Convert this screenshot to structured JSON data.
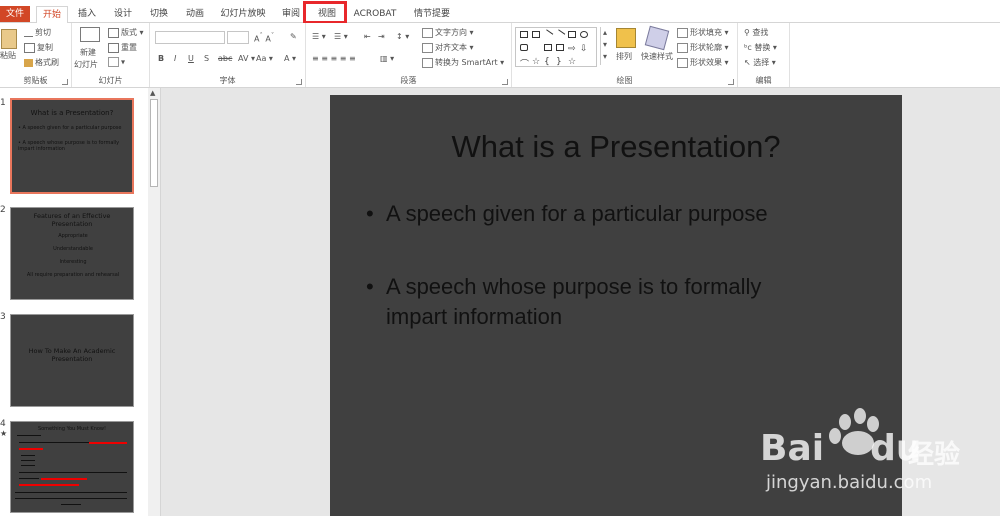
{
  "tabs": {
    "file": "文件",
    "home": "开始",
    "insert": "插入",
    "design": "设计",
    "transitions": "切换",
    "animations": "动画",
    "slideshow": "幻灯片放映",
    "review": "审阅",
    "view": "视图",
    "acrobat": "ACROBAT",
    "storyboard": "情节提要"
  },
  "ribbon": {
    "clipboard": {
      "paste": "粘贴",
      "cut": "剪切",
      "copy": "复制",
      "format_painter": "格式刷",
      "label": "剪贴板"
    },
    "slides": {
      "new_slide": "新建",
      "new_slide2": "幻灯片",
      "layout": "版式",
      "reset": "重置",
      "label": "幻灯片"
    },
    "font": {
      "label": "字体"
    },
    "paragraph": {
      "text_direction": "文字方向",
      "align_text": "对齐文本",
      "convert_smartart": "转换为 SmartArt",
      "label": "段落"
    },
    "drawing": {
      "arrange": "排列",
      "quick_styles": "快速样式",
      "shape_fill": "形状填充",
      "shape_outline": "形状轮廓",
      "shape_effects": "形状效果",
      "label": "绘图"
    },
    "editing": {
      "find": "查找",
      "replace": "替换",
      "select": "选择",
      "label": "编辑"
    }
  },
  "thumbnails": [
    {
      "num": "1",
      "title": "What is a Presentation?",
      "lines": [
        "• A speech given for a particular purpose",
        "• A speech whose purpose is to formally impart information"
      ]
    },
    {
      "num": "2",
      "title": "Features of an Effective Presentation",
      "lines": [
        "Appropriate",
        "Understandable",
        "Interesting",
        "All require preparation and rehearsal"
      ]
    },
    {
      "num": "3",
      "title": "How To Make An Academic Presentation",
      "lines": []
    },
    {
      "num": "4",
      "title": "Something You Must Know!"
    }
  ],
  "slide": {
    "title": "What is a Presentation?",
    "bullets": [
      {
        "dot": "•",
        "text": "A speech given for a particular purpose"
      },
      {
        "dot": "•",
        "text": "A speech whose purpose is to formally"
      },
      {
        "dot": "",
        "text": "impart information"
      }
    ]
  },
  "watermark": {
    "brand": "Bai",
    "brand2": "du",
    "cn": "经验",
    "url": "jingyan.baidu.com"
  }
}
